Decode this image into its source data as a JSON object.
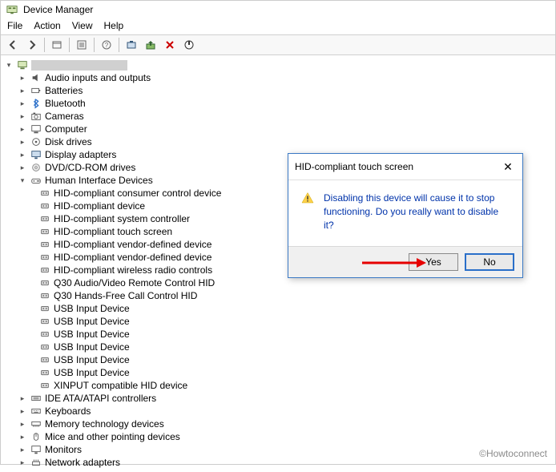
{
  "window": {
    "title": "Device Manager"
  },
  "menu": {
    "file": "File",
    "action": "Action",
    "view": "View",
    "help": "Help"
  },
  "tree": {
    "root_expanded": true,
    "categories": [
      {
        "label": "Audio inputs and outputs",
        "icon": "speaker",
        "expanded": false,
        "children": []
      },
      {
        "label": "Batteries",
        "icon": "battery",
        "expanded": false,
        "children": []
      },
      {
        "label": "Bluetooth",
        "icon": "bluetooth",
        "expanded": false,
        "children": []
      },
      {
        "label": "Cameras",
        "icon": "camera",
        "expanded": false,
        "children": []
      },
      {
        "label": "Computer",
        "icon": "computer",
        "expanded": false,
        "children": []
      },
      {
        "label": "Disk drives",
        "icon": "disk",
        "expanded": false,
        "children": []
      },
      {
        "label": "Display adapters",
        "icon": "display",
        "expanded": false,
        "children": []
      },
      {
        "label": "DVD/CD-ROM drives",
        "icon": "cd",
        "expanded": false,
        "children": []
      },
      {
        "label": "Human Interface Devices",
        "icon": "hid",
        "expanded": true,
        "children": [
          {
            "label": "HID-compliant consumer control device",
            "icon": "hid-dev"
          },
          {
            "label": "HID-compliant device",
            "icon": "hid-dev"
          },
          {
            "label": "HID-compliant system controller",
            "icon": "hid-dev"
          },
          {
            "label": "HID-compliant touch screen",
            "icon": "hid-dev"
          },
          {
            "label": "HID-compliant vendor-defined device",
            "icon": "hid-dev"
          },
          {
            "label": "HID-compliant vendor-defined device",
            "icon": "hid-dev"
          },
          {
            "label": "HID-compliant wireless radio controls",
            "icon": "hid-dev"
          },
          {
            "label": "Q30 Audio/Video Remote Control HID",
            "icon": "hid-dev"
          },
          {
            "label": "Q30 Hands-Free Call Control HID",
            "icon": "hid-dev"
          },
          {
            "label": "USB Input Device",
            "icon": "hid-dev"
          },
          {
            "label": "USB Input Device",
            "icon": "hid-dev"
          },
          {
            "label": "USB Input Device",
            "icon": "hid-dev"
          },
          {
            "label": "USB Input Device",
            "icon": "hid-dev"
          },
          {
            "label": "USB Input Device",
            "icon": "hid-dev"
          },
          {
            "label": "USB Input Device",
            "icon": "hid-dev"
          },
          {
            "label": "XINPUT compatible HID device",
            "icon": "hid-dev"
          }
        ]
      },
      {
        "label": "IDE ATA/ATAPI controllers",
        "icon": "ide",
        "expanded": false,
        "children": []
      },
      {
        "label": "Keyboards",
        "icon": "keyboard",
        "expanded": false,
        "children": []
      },
      {
        "label": "Memory technology devices",
        "icon": "memory",
        "expanded": false,
        "children": []
      },
      {
        "label": "Mice and other pointing devices",
        "icon": "mouse",
        "expanded": false,
        "children": []
      },
      {
        "label": "Monitors",
        "icon": "monitor",
        "expanded": false,
        "children": []
      },
      {
        "label": "Network adapters",
        "icon": "network",
        "expanded": false,
        "children": []
      }
    ]
  },
  "dialog": {
    "title": "HID-compliant touch screen",
    "message": "Disabling this device will cause it to stop functioning. Do you really want to disable it?",
    "yes": "Yes",
    "no": "No"
  },
  "watermark": "©Howtoconnect"
}
